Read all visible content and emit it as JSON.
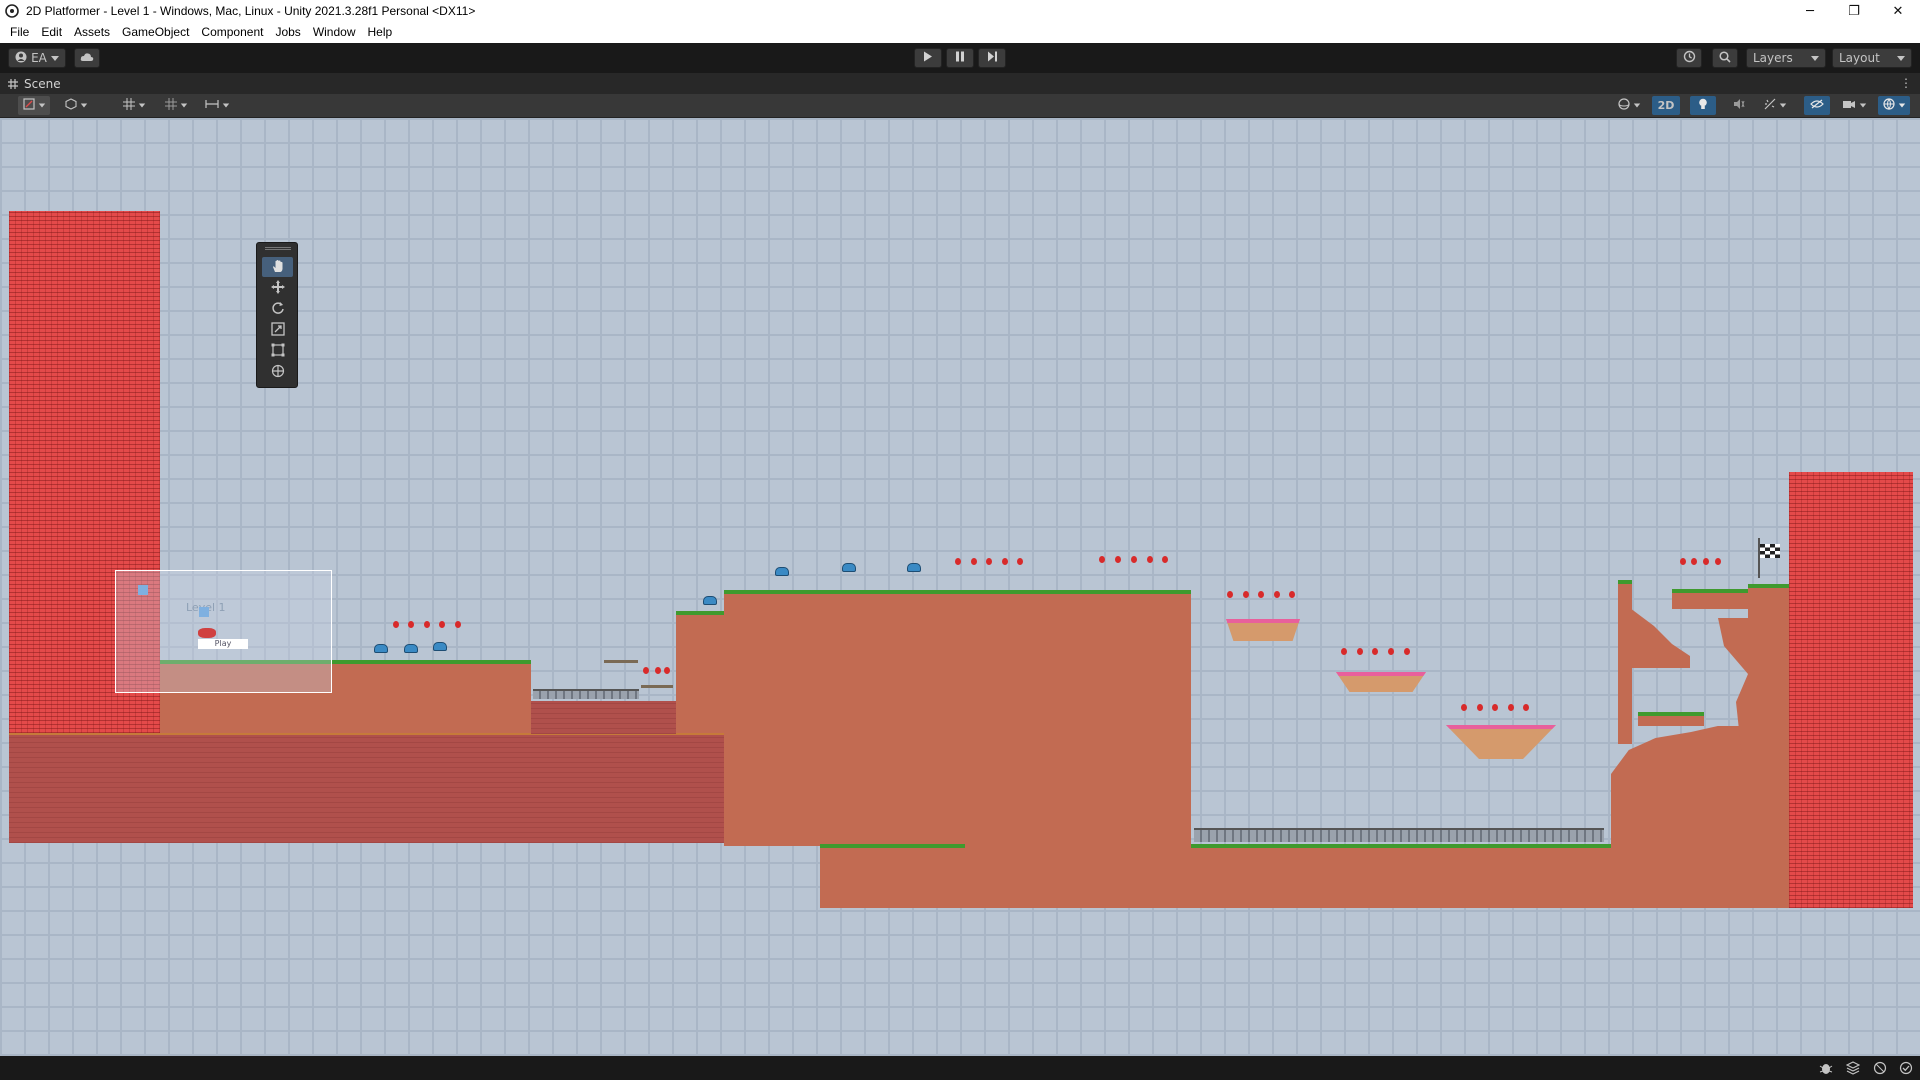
{
  "window": {
    "title": "2D Platformer - Level 1 - Windows, Mac, Linux - Unity 2021.3.28f1 Personal <DX11>",
    "minimize": "─",
    "restore": "❐",
    "close": "✕"
  },
  "menu": {
    "items": [
      "File",
      "Edit",
      "Assets",
      "GameObject",
      "Component",
      "Jobs",
      "Window",
      "Help"
    ]
  },
  "toolbar": {
    "account_label": "EA",
    "layers_label": "Layers",
    "layout_label": "Layout",
    "icons": {
      "account": "account-icon",
      "cloud": "cloud-icon",
      "play": "play-icon",
      "pause": "pause-icon",
      "step": "step-icon",
      "history": "undo-history-icon",
      "search": "search-icon"
    }
  },
  "scene_tab": {
    "label": "Scene",
    "icon": "grid-icon"
  },
  "scene_toolbar": {
    "mode_2d_label": "2D"
  },
  "scene_overlay": {
    "level_title_text": "Level 1",
    "play_button_text": "Play"
  },
  "colors": {
    "accent_blue": "#2c5d87",
    "scene_bg": "#b9c5d3",
    "wall_red": "#e44a4a",
    "dirt": "#c26b52",
    "grass": "#3f9a2e",
    "pink_platform": "#e8609c"
  }
}
